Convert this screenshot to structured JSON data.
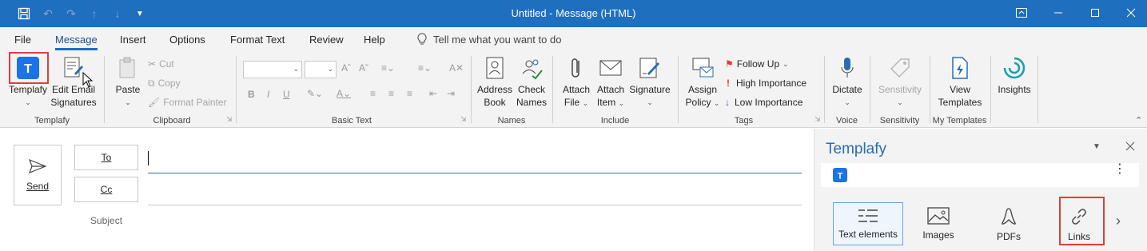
{
  "titlebar": {
    "title": "Untitled  -  Message (HTML)",
    "icons": [
      "save-icon",
      "undo-icon",
      "redo-icon",
      "arrow-up-icon",
      "arrow-down-icon",
      "customize-quick-access-icon"
    ],
    "window_controls": [
      "ribbon-display-options-icon",
      "minimize-icon",
      "maximize-icon",
      "close-icon"
    ]
  },
  "menu": {
    "items": [
      "File",
      "Message",
      "Insert",
      "Options",
      "Format Text",
      "Review",
      "Help"
    ],
    "active": "Message",
    "tell_me": "Tell me what you want to do"
  },
  "ribbon": {
    "templafy": {
      "label": "Templafy",
      "edit_email_line1": "Edit Email",
      "edit_email_line2": "Signatures",
      "group": "Templafy"
    },
    "clipboard": {
      "paste": "Paste",
      "cut": "Cut",
      "copy": "Copy",
      "format_painter": "Format Painter",
      "group": "Clipboard"
    },
    "basic_text": {
      "group": "Basic Text",
      "bold": "B",
      "italic": "I",
      "underline": "U"
    },
    "names": {
      "address_line1": "Address",
      "address_line2": "Book",
      "check_line1": "Check",
      "check_line2": "Names",
      "group": "Names"
    },
    "include": {
      "attach_file_line1": "Attach",
      "attach_file_line2": "File",
      "attach_item_line1": "Attach",
      "attach_item_line2": "Item",
      "signature": "Signature",
      "group": "Include"
    },
    "tags": {
      "assign_line1": "Assign",
      "assign_line2": "Policy",
      "follow_up": "Follow Up",
      "high": "High Importance",
      "low": "Low Importance",
      "group": "Tags"
    },
    "voice": {
      "dictate": "Dictate",
      "group": "Voice"
    },
    "sensitivity": {
      "label": "Sensitivity",
      "group": "Sensitivity"
    },
    "my_templates": {
      "view_line1": "View",
      "view_line2": "Templates",
      "group": "My Templates"
    },
    "insights": {
      "label": "Insights"
    }
  },
  "compose": {
    "send": "Send",
    "to": "To",
    "cc": "Cc",
    "subject": "Subject",
    "to_value": "",
    "cc_value": ""
  },
  "panel": {
    "title": "Templafy",
    "categories": [
      "Text elements",
      "Images",
      "PDFs",
      "Links"
    ],
    "selected": "Text elements",
    "highlighted": "Links"
  },
  "colors": {
    "titlebar": "#1f6fbf",
    "accent": "#2b6cb0",
    "highlight_box": "#e03c3c",
    "follow_up_flag": "#e03c3c",
    "low_importance_arrow": "#2b6cb0"
  }
}
